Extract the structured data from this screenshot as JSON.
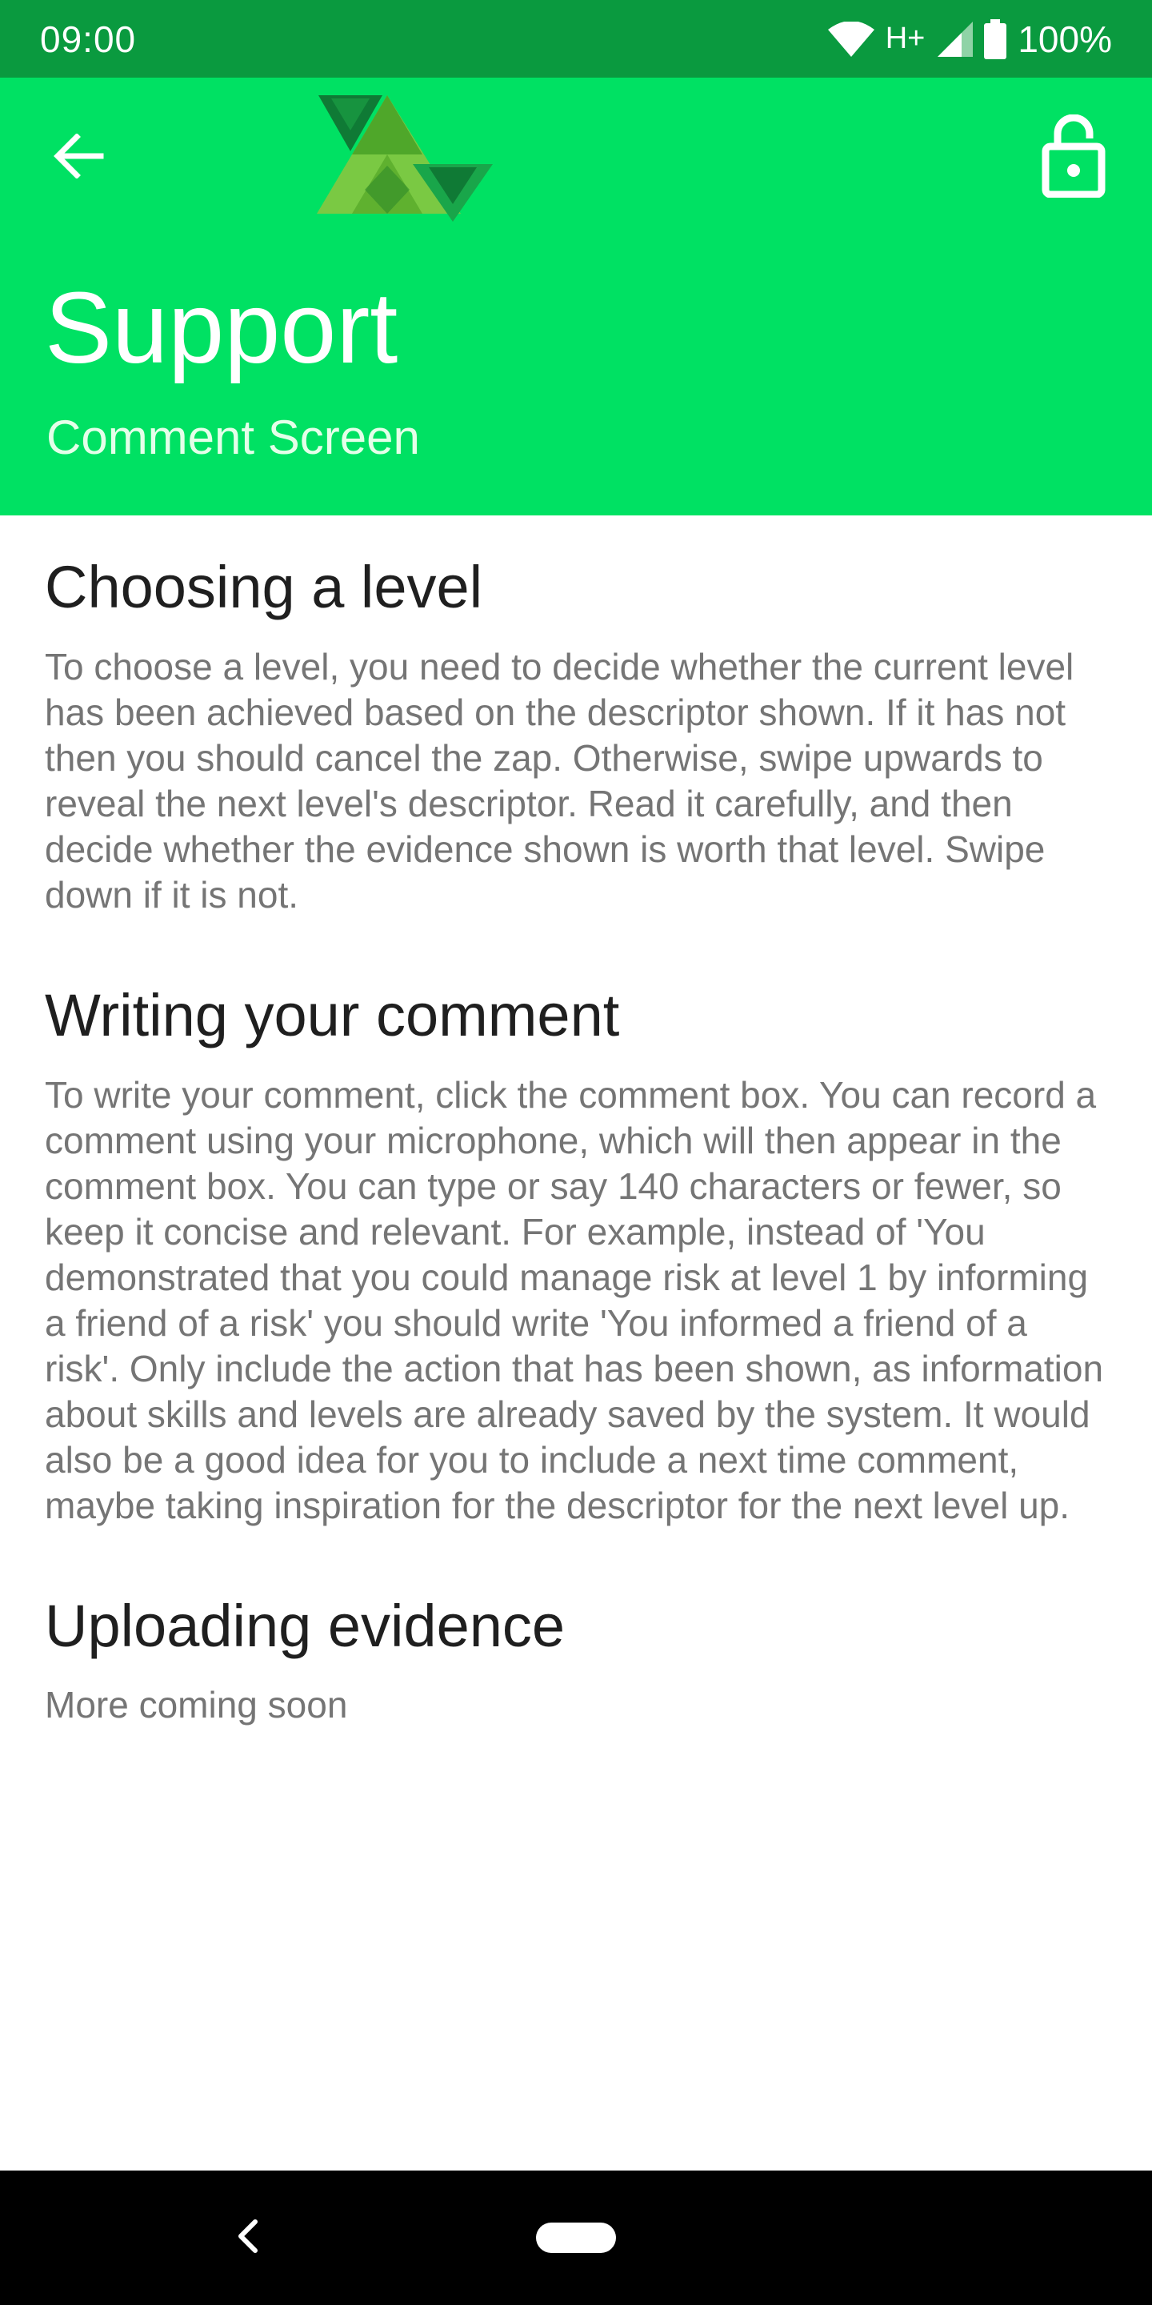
{
  "status_bar": {
    "time": "09:00",
    "network": "H+",
    "battery": "100%",
    "icons": [
      "wifi-icon",
      "signal-icon",
      "battery-icon"
    ]
  },
  "header": {
    "title": "Support",
    "subtitle": "Comment Screen",
    "back_icon": "arrow-left-icon",
    "lock_icon": "lock-open-icon",
    "background_color": "#00e163"
  },
  "sections": [
    {
      "title": "Choosing a level",
      "body": "To choose a level, you need to decide whether the current level has been achieved based on the descriptor shown. If it has not then you should cancel the zap. Otherwise, swipe upwards to reveal the next level's descriptor. Read it carefully, and then decide whether the evidence shown is worth that level. Swipe down if it is not."
    },
    {
      "title": "Writing your comment",
      "body": "To write your comment, click the comment box. You can record a comment using your microphone, which will then appear in the comment box. You can type or say 140 characters or fewer, so keep it concise and relevant. For example, instead of 'You demonstrated that you could manage risk at level 1 by informing a friend of a risk' you should write 'You informed a friend of a risk'. Only include the action that has been shown, as information about skills and levels are already saved by the system. It would also be a good idea for you to include a next time comment, maybe taking inspiration for the descriptor for the next level up."
    },
    {
      "title": "Uploading evidence",
      "body": "More coming soon"
    }
  ],
  "nav_bar": {
    "back_icon": "chevron-left-icon",
    "home_icon": "home-pill-icon"
  }
}
